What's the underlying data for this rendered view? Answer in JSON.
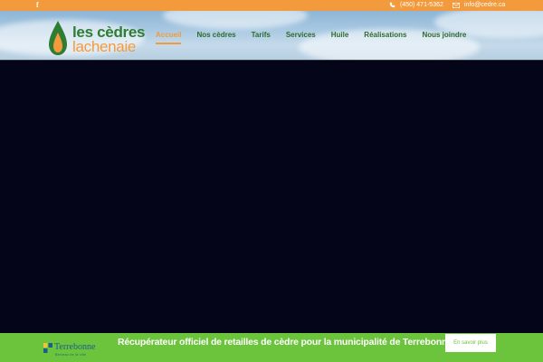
{
  "topbar": {
    "facebook_label": "f",
    "phone": "(450) 471-5362",
    "email": "info@cedre.ca"
  },
  "logo": {
    "line1": "les cèdres",
    "line2": "lachenaie"
  },
  "nav": {
    "items": [
      "Accueil",
      "Nos cèdres",
      "Tarifs",
      "Services",
      "Huile",
      "Réalisations",
      "Nous joindre"
    ],
    "active": "Accueil"
  },
  "bottom": {
    "message": "Récupérateur officiel de retailles de cèdre pour la municipalité de Terrebonne",
    "button_label": "En savoir plus"
  },
  "terrebonne": {
    "name": "Terrebonne",
    "subtitle": "Berceau de la ville"
  },
  "colors": {
    "orange": "#f39a3c",
    "green": "#6bc43c",
    "dark_green": "#2e7d32",
    "hero": "#050519"
  }
}
